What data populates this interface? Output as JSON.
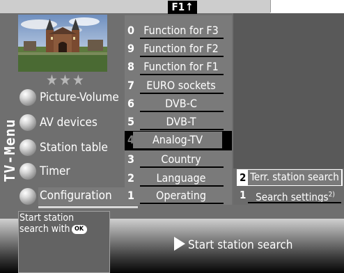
{
  "header": {
    "f1_label": "F1",
    "f1_arrow": "🡑"
  },
  "picture": {
    "stars": "★★★"
  },
  "menu": {
    "title": "TV-Menu",
    "items": [
      {
        "label": "Picture-Volume"
      },
      {
        "label": "AV devices"
      },
      {
        "label": "Station table"
      },
      {
        "label": "Timer"
      },
      {
        "label": "Configuration",
        "selected": true
      }
    ]
  },
  "config_list": [
    {
      "num": "0",
      "label": "Function for F3"
    },
    {
      "num": "9",
      "label": "Function for F2"
    },
    {
      "num": "8",
      "label": "Function for F1"
    },
    {
      "num": "7",
      "label": "EURO sockets"
    },
    {
      "num": "6",
      "label": "DVB-C"
    },
    {
      "num": "5",
      "label": "DVB-T"
    },
    {
      "num": "4",
      "label": "Analog-TV",
      "selected": true
    },
    {
      "num": "3",
      "label": "Country"
    },
    {
      "num": "2",
      "label": "Language"
    },
    {
      "num": "1",
      "label": "Operating"
    }
  ],
  "submenu": [
    {
      "num": "2",
      "label": "Terr. station search",
      "selected": true
    },
    {
      "num": "1",
      "label": "Search settings",
      "footnote": "2)"
    }
  ],
  "info": {
    "line1": "Start station",
    "line2": "search with",
    "ok_badge": "OK"
  },
  "action": {
    "label": "Start station search"
  },
  "colors": {
    "panel": "#6f6f6f",
    "list": "#7a7a7a",
    "dark": "#595959",
    "highlight": "#000000"
  }
}
